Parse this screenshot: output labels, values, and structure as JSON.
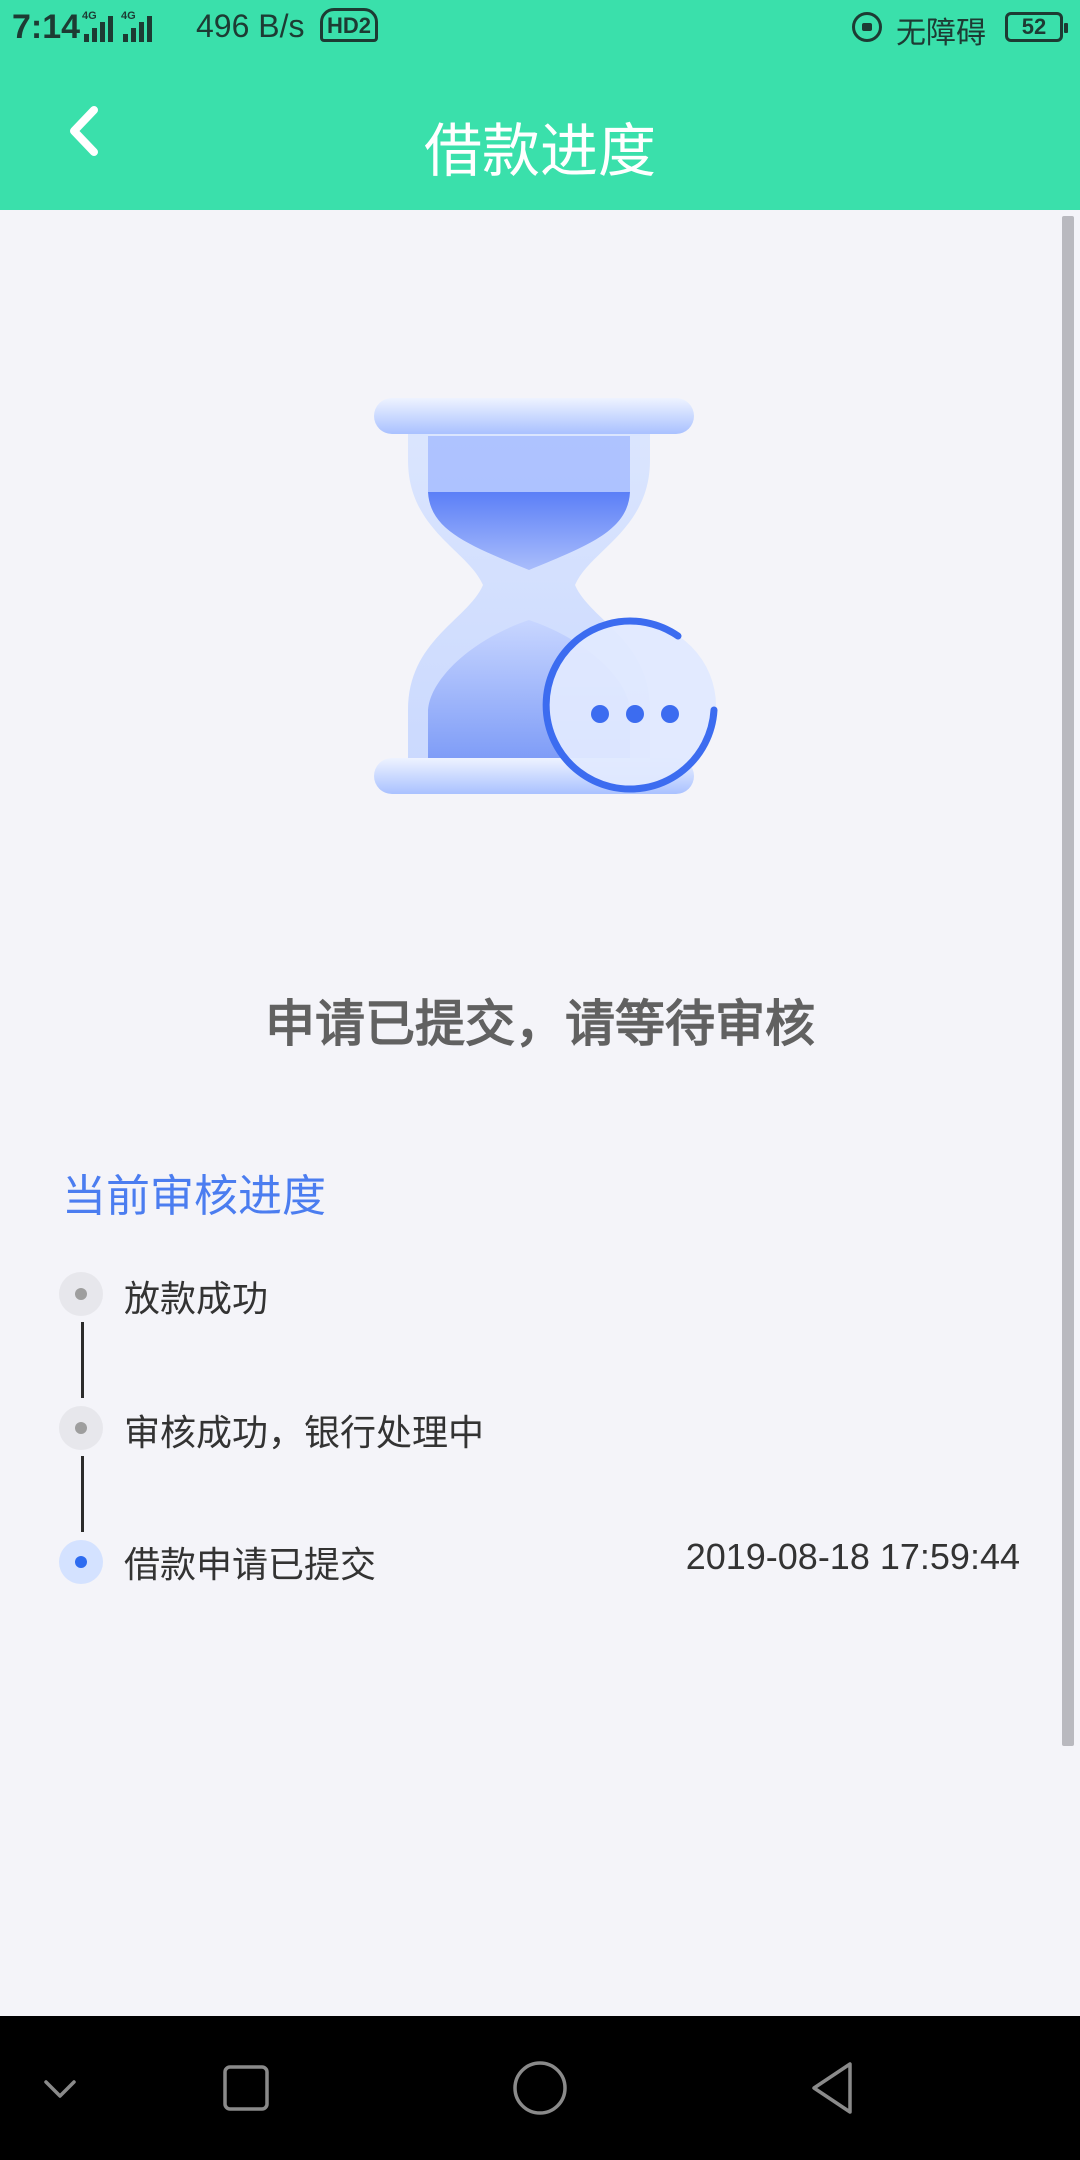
{
  "status_bar": {
    "time": "7:14",
    "network_1": "4G",
    "network_2": "4G",
    "speed": "496 B/s",
    "hd_badge": "HD2",
    "accessibility": "无障碍",
    "battery": "52"
  },
  "app_bar": {
    "title": "借款进度",
    "back_icon": "chevron-left-icon"
  },
  "status": {
    "illustration_icon": "hourglass-icon",
    "message": "申请已提交，请等待审核"
  },
  "progress": {
    "heading": "当前审核进度",
    "steps": [
      {
        "label": "放款成功",
        "time": "",
        "active": false
      },
      {
        "label": "审核成功，银行处理中",
        "time": "",
        "active": false
      },
      {
        "label": "借款申请已提交",
        "time": "2019-08-18 17:59:44",
        "active": true
      }
    ]
  },
  "nav_bar": {
    "icons": [
      "chevron-down-icon",
      "recents-icon",
      "home-icon",
      "back-icon"
    ]
  },
  "colors": {
    "header": "#3ae0ab",
    "accent": "#4b7df0",
    "active_dot": "#2e6cf0",
    "background": "#f4f4f9"
  }
}
